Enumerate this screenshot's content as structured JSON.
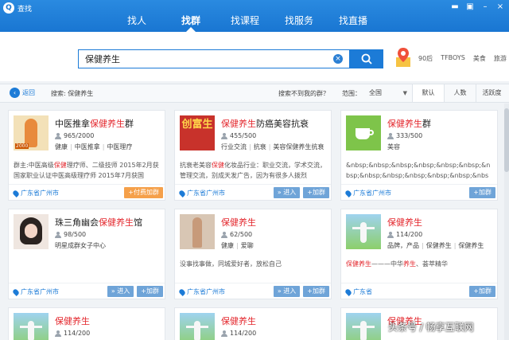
{
  "window": {
    "title": "查找",
    "logo_glyph": "Q"
  },
  "nav": {
    "tabs": [
      {
        "label": "找人"
      },
      {
        "label": "找群"
      },
      {
        "label": "找课程"
      },
      {
        "label": "找服务"
      },
      {
        "label": "找直播"
      }
    ],
    "active": "找群"
  },
  "search": {
    "value": "保健养生",
    "clear_glyph": "×"
  },
  "hot_tags": [
    "90后",
    "TFBOYS",
    "美食",
    "旅游"
  ],
  "filter": {
    "back_label": "返回",
    "back_glyph": "‹",
    "crumb": "搜索: 保健养生",
    "not_found": "搜索不到我的群？",
    "range_label": "范围：",
    "range_value": "全国",
    "range_caret": "▼",
    "sort_tabs": [
      "默认",
      "人数",
      "活跃度"
    ]
  },
  "cards": [
    {
      "title_pre": "中医推拿",
      "title_hl": "保健养生",
      "title_post": "群",
      "members": "965/2000",
      "tags": [
        "健康",
        "中医推拿",
        "中医理疗"
      ],
      "desc_pre": "群主:中医高级",
      "desc_hl": "保健",
      "desc_post": "理疗师、二级技师 2015年2月获国家职业认证中医高级理疗师 2015年7月获国",
      "location": "广东省广州市",
      "buttons": [
        "+付费加群"
      ],
      "avatar_label": "2000"
    },
    {
      "title_pre": "",
      "title_hl": "保健养生",
      "title_post": "防癌美容抗衰",
      "members": "455/500",
      "tags": [
        "行业交流",
        "抗衰",
        "美容保健养生抗衰"
      ],
      "desc_pre": "抗衰老美容",
      "desc_hl": "保健",
      "desc_post": "化妆品行业：职业交流，学术交流，管理交流，别成天发广告，因为有很多人拨烈",
      "location": "广东省广州市",
      "buttons": [
        "» 进入",
        "+加群"
      ],
      "avatar_label": "创富生"
    },
    {
      "title_pre": "",
      "title_hl": "保健养生",
      "title_post": "群",
      "members": "333/500",
      "tags": [
        "美容"
      ],
      "desc_pre": "&nbsp;&nbsp;&nbsp;&nbsp;&nbsp;&nbsp;&nbsp;&nbsp;&nbsp;&nbsp;&nbsp;&nbsp;&nbsp;&nbsp;&nbsp;&nbsp;&nbsp;",
      "desc_hl": "",
      "desc_post": "",
      "location": "广东省广州市",
      "buttons": [
        "+加群"
      ]
    },
    {
      "title_pre": "珠三角幽会",
      "title_hl": "保健养生",
      "title_post": "馆",
      "members": "98/500",
      "tags": [
        "明星成群女子中心"
      ],
      "desc_pre": "",
      "desc_hl": "",
      "desc_post": "",
      "location": "广东省广州市",
      "buttons": [
        "» 进入",
        "+加群"
      ]
    },
    {
      "title_pre": "",
      "title_hl": "保健养生",
      "title_post": "",
      "members": "62/500",
      "tags": [
        "健康",
        "爱聊"
      ],
      "desc_pre": "没事找事做，同城爱好者，放松自己",
      "desc_hl": "",
      "desc_post": "",
      "location": "广东省广州市",
      "buttons": [
        "» 进入",
        "+加群"
      ]
    },
    {
      "title_pre": "",
      "title_hl": "保健养生",
      "title_post": "",
      "members": "114/200",
      "tags": [
        "品牌，产品",
        "保健养生",
        "保健养生"
      ],
      "desc_pre": "",
      "desc_hl": "保健养生",
      "desc_post": "———中华",
      "desc_hl2": "养生",
      "desc_post2": "、荟萃精华",
      "location": "广东省",
      "buttons": [
        "+加群"
      ]
    },
    {
      "title_pre": "",
      "title_hl": "保健养生",
      "title_post": "",
      "members": "114/200",
      "tags": [],
      "desc_pre": "",
      "desc_hl": "",
      "desc_post": "",
      "location": "",
      "buttons": []
    },
    {
      "title_pre": "",
      "title_hl": "保健养生",
      "title_post": "",
      "members": "114/200",
      "tags": [],
      "desc_pre": "",
      "desc_hl": "",
      "desc_post": "",
      "location": "",
      "buttons": []
    },
    {
      "title_pre": "",
      "title_hl": "保健养生",
      "title_post": "",
      "members": "",
      "tags": [],
      "desc_pre": "",
      "desc_hl": "",
      "desc_post": "",
      "location": "",
      "buttons": []
    }
  ],
  "watermark": "头条号 / 畅享互联网",
  "colors": {
    "accent": "#1c7bd7",
    "highlight": "#e3262c",
    "pay_button": "#f5a04a"
  }
}
